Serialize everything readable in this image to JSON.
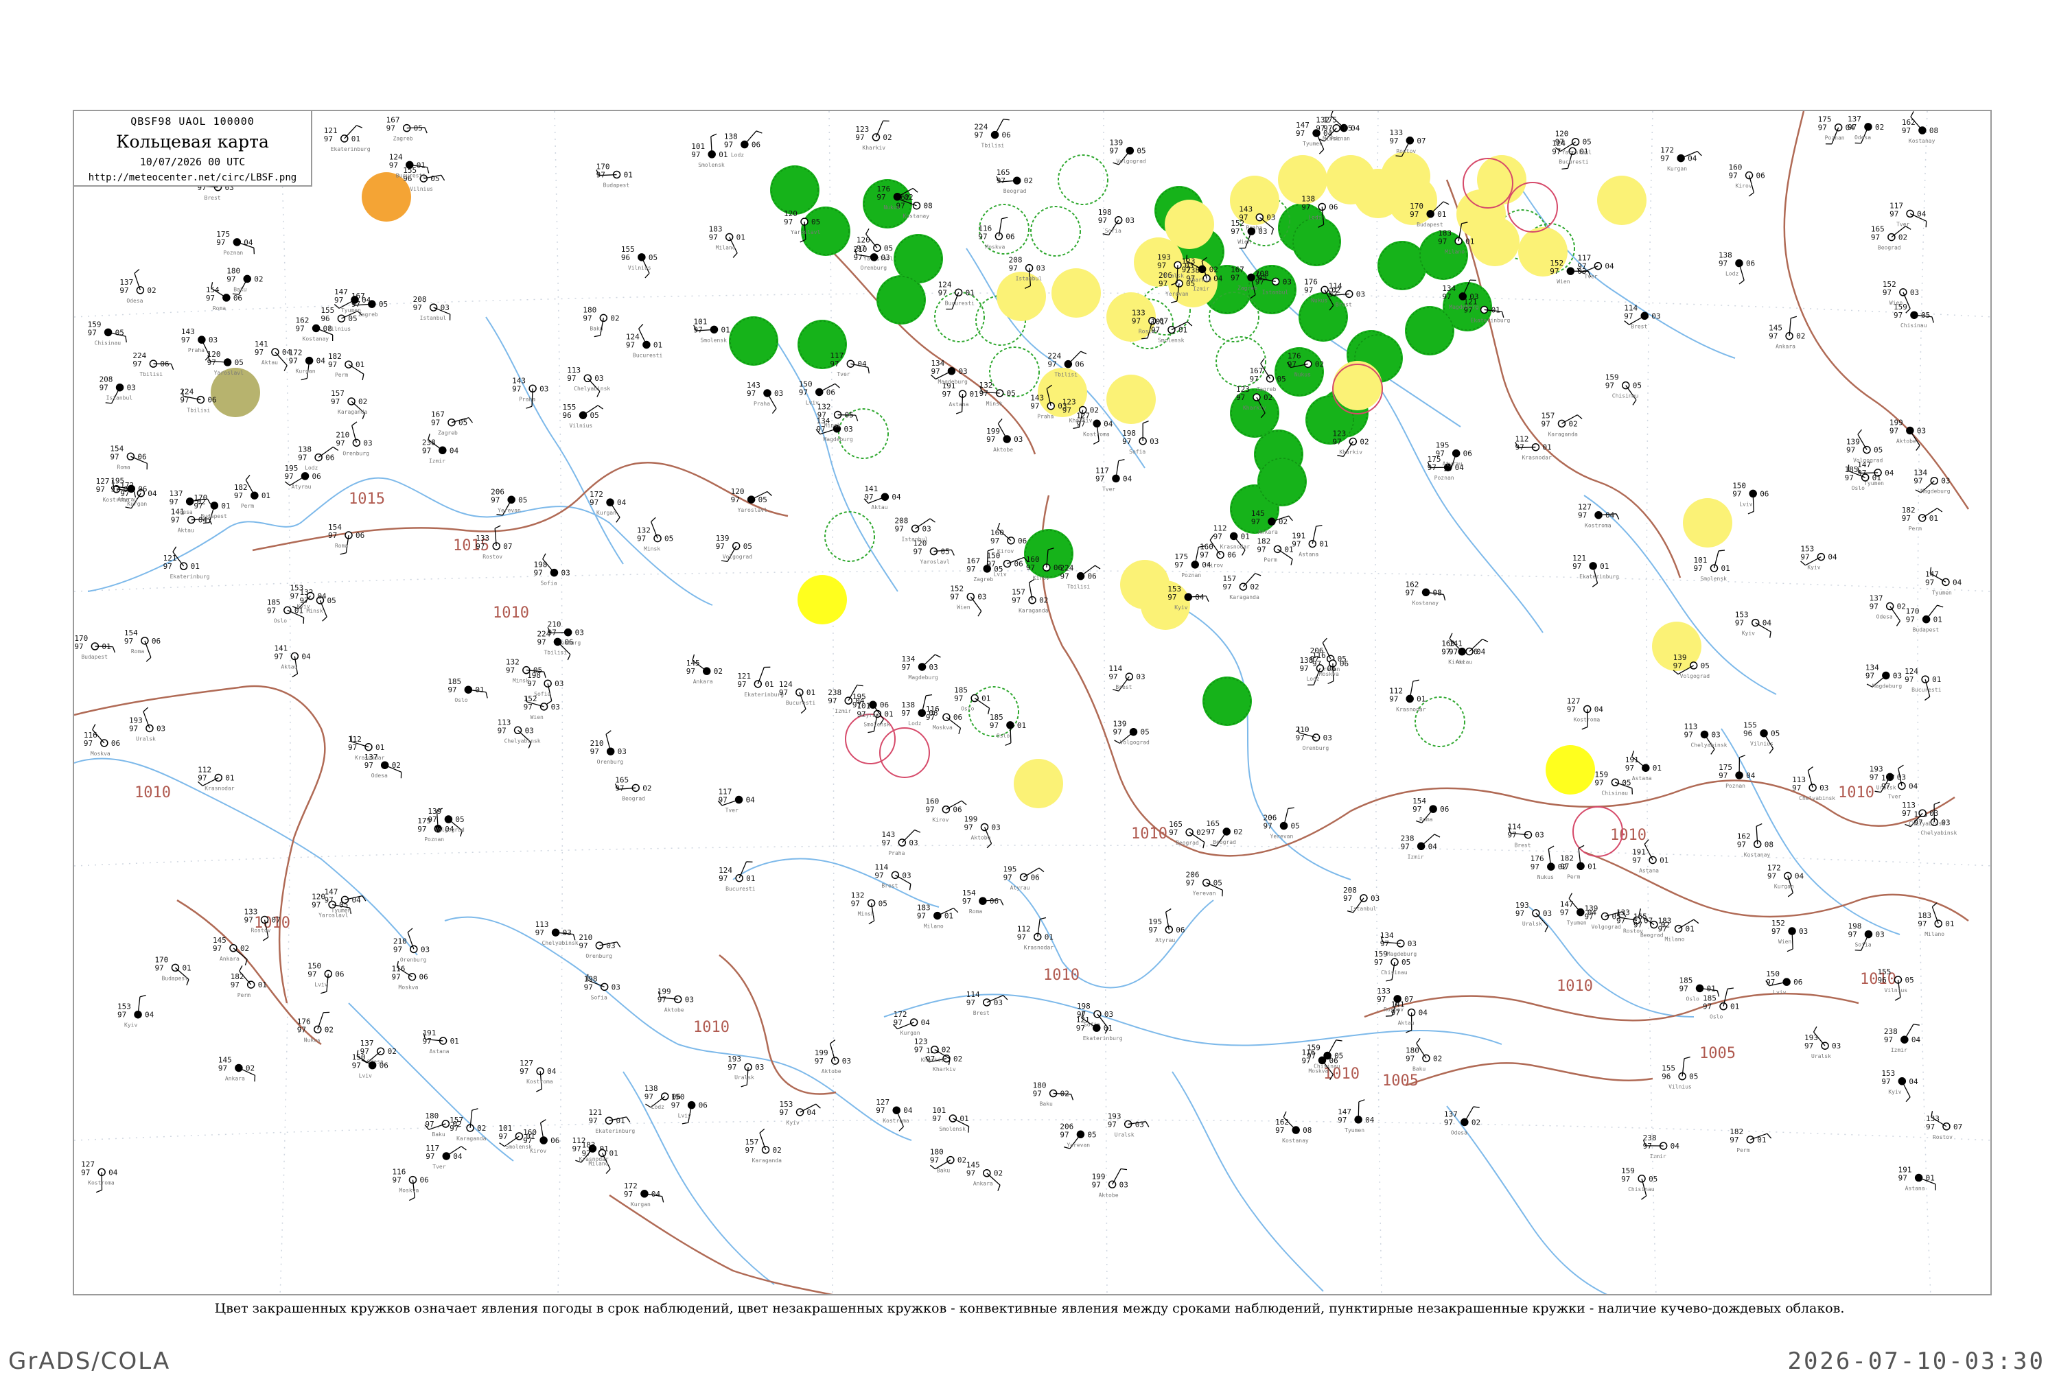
{
  "header": {
    "code_line": "QBSF98  UAOL  100000",
    "title": "Кольцевая карта",
    "date_line": "10/07/2026 00 UTC",
    "url": "http://meteocenter.net/circ/LBSF.png"
  },
  "caption": "Цвет закрашенных кружков означает явления погоды в срок наблюдений, цвет незакрашенных кружков - конвективные явления между сроками наблюдений, пунктирные незакрашенные кружки - наличие кучево-дождевых облаков.",
  "footer": {
    "left": "GrADS/COLA",
    "right": "2026-07-10-03:30"
  },
  "colors": {
    "thunderstorm": "#16b31a",
    "rain": "#fbf276",
    "shower": "#ffff1e",
    "fog": "#f4a435",
    "haze": "#b7b36e",
    "convective_ring": "#2fa82f",
    "hail_ring": "#d64a6a",
    "isobar": "#b06a55",
    "water": "#7db9ea"
  },
  "isobar_labels": [
    "1015",
    "1015",
    "1010",
    "1010",
    "1010",
    "1010",
    "1010",
    "1010",
    "1010",
    "1010",
    "1010",
    "1010",
    "1010",
    "1005",
    "1005"
  ],
  "stations": [
    {
      "p": "185",
      "t": "97",
      "d": "01",
      "name": "Oslo"
    },
    {
      "p": "134",
      "t": "97",
      "d": "03",
      "name": "Magdeburg"
    },
    {
      "p": "175",
      "t": "97",
      "d": "04",
      "name": "Poznan"
    },
    {
      "p": "138",
      "t": "97",
      "d": "06",
      "name": "Lodz"
    },
    {
      "p": "114",
      "t": "97",
      "d": "03",
      "name": "Brest"
    },
    {
      "p": "155",
      "t": "96",
      "d": "05",
      "name": "Vilnius"
    },
    {
      "p": "132",
      "t": "97",
      "d": "05",
      "name": "Minsk"
    },
    {
      "p": "101",
      "t": "97",
      "d": "01",
      "name": "Smolensk"
    },
    {
      "p": "116",
      "t": "97",
      "d": "06",
      "name": "Moskva"
    },
    {
      "p": "117",
      "t": "97",
      "d": "04",
      "name": "Tver"
    },
    {
      "p": "120",
      "t": "97",
      "d": "05",
      "name": "Yaroslavl"
    },
    {
      "p": "127",
      "t": "97",
      "d": "04",
      "name": "Kostroma"
    },
    {
      "p": "160",
      "t": "97",
      "d": "06",
      "name": "Kirov"
    },
    {
      "p": "182",
      "t": "97",
      "d": "01",
      "name": "Perm"
    },
    {
      "p": "121",
      "t": "97",
      "d": "01",
      "name": "Ekaterinburg"
    },
    {
      "p": "147",
      "t": "97",
      "d": "04",
      "name": "Tyumen"
    },
    {
      "p": "172",
      "t": "97",
      "d": "04",
      "name": "Kurgan"
    },
    {
      "p": "113",
      "t": "97",
      "d": "03",
      "name": "Chelyabinsk"
    },
    {
      "p": "210",
      "t": "97",
      "d": "03",
      "name": "Orenburg"
    },
    {
      "p": "193",
      "t": "97",
      "d": "03",
      "name": "Uralsk"
    },
    {
      "p": "139",
      "t": "97",
      "d": "05",
      "name": "Volgograd"
    },
    {
      "p": "133",
      "t": "97",
      "d": "07",
      "name": "Rostov"
    },
    {
      "p": "112",
      "t": "97",
      "d": "01",
      "name": "Krasnodar"
    },
    {
      "p": "153",
      "t": "97",
      "d": "04",
      "name": "Kyiv"
    },
    {
      "p": "123",
      "t": "97",
      "d": "02",
      "name": "Kharkiv"
    },
    {
      "p": "150",
      "t": "97",
      "d": "06",
      "name": "Lviv"
    },
    {
      "p": "137",
      "t": "97",
      "d": "02",
      "name": "Odesa"
    },
    {
      "p": "159",
      "t": "97",
      "d": "05",
      "name": "Chisinau"
    },
    {
      "p": "124",
      "t": "97",
      "d": "01",
      "name": "Bucuresti"
    },
    {
      "p": "198",
      "t": "97",
      "d": "03",
      "name": "Sofia"
    },
    {
      "p": "165",
      "t": "97",
      "d": "02",
      "name": "Beograd"
    },
    {
      "p": "170",
      "t": "97",
      "d": "01",
      "name": "Budapest"
    },
    {
      "p": "152",
      "t": "97",
      "d": "03",
      "name": "Wien"
    },
    {
      "p": "143",
      "t": "97",
      "d": "03",
      "name": "Praha"
    },
    {
      "p": "167",
      "t": "97",
      "d": "05",
      "name": "Zagreb"
    },
    {
      "p": "183",
      "t": "97",
      "d": "01",
      "name": "Milano"
    },
    {
      "p": "154",
      "t": "97",
      "d": "06",
      "name": "Roma"
    },
    {
      "p": "145",
      "t": "97",
      "d": "02",
      "name": "Ankara"
    },
    {
      "p": "238",
      "t": "97",
      "d": "04",
      "name": "Izmir"
    },
    {
      "p": "208",
      "t": "97",
      "d": "03",
      "name": "Istanbul"
    },
    {
      "p": "224",
      "t": "97",
      "d": "06",
      "name": "Tbilisi"
    },
    {
      "p": "206",
      "t": "97",
      "d": "05",
      "name": "Yerevan"
    },
    {
      "p": "180",
      "t": "97",
      "d": "02",
      "name": "Baku"
    },
    {
      "p": "195",
      "t": "97",
      "d": "06",
      "name": "Atyrau"
    },
    {
      "p": "199",
      "t": "97",
      "d": "03",
      "name": "Aktobe"
    },
    {
      "p": "162",
      "t": "97",
      "d": "08",
      "name": "Kostanay"
    },
    {
      "p": "191",
      "t": "97",
      "d": "01",
      "name": "Astana"
    },
    {
      "p": "157",
      "t": "97",
      "d": "02",
      "name": "Karaganda"
    },
    {
      "p": "141",
      "t": "97",
      "d": "04",
      "name": "Aktau"
    },
    {
      "p": "176",
      "t": "97",
      "d": "02",
      "name": "Nukus"
    }
  ]
}
